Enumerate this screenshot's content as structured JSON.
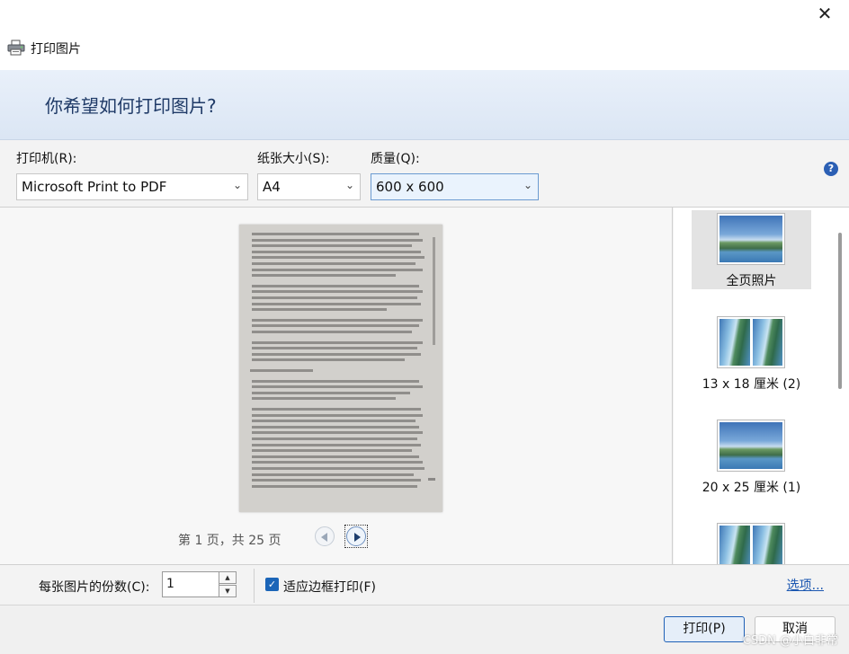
{
  "window": {
    "close_glyph": "✕",
    "title": "打印图片"
  },
  "banner": {
    "heading": "你希望如何打印图片?"
  },
  "options": {
    "printer_label": "打印机(R):",
    "printer_value": "Microsoft Print to PDF",
    "paper_label": "纸张大小(S):",
    "paper_value": "A4",
    "quality_label": "质量(Q):",
    "quality_value": "600 x 600",
    "help_glyph": "?"
  },
  "preview": {
    "page_indicator": "第 1 页，共 25 页"
  },
  "layouts": [
    {
      "label": "全页照片",
      "style": "landscape",
      "selected": true
    },
    {
      "label": "13 x 18 厘米 (2)",
      "style": "split",
      "selected": false
    },
    {
      "label": "20 x 25 厘米 (1)",
      "style": "landscape",
      "selected": false
    },
    {
      "label": "",
      "style": "split",
      "selected": false
    }
  ],
  "copies": {
    "label": "每张图片的份数(C):",
    "value": "1",
    "spin_up": "▲",
    "spin_down": "▼"
  },
  "fit": {
    "checked": true,
    "check_glyph": "✓",
    "label": "适应边框打印(F)"
  },
  "options_link": "选项...",
  "buttons": {
    "print": "打印(P)",
    "cancel": "取消"
  },
  "watermark": "CSDN @小白非常",
  "colors": {
    "accent": "#1b65b8",
    "banner_text": "#1f3a67",
    "link": "#1a56b0"
  }
}
